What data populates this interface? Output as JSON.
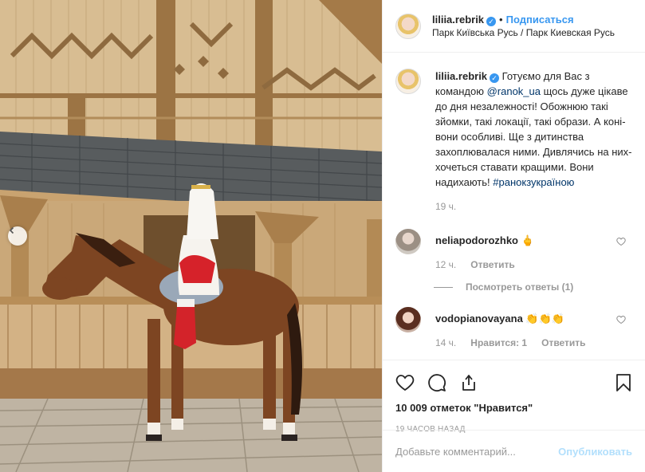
{
  "post": {
    "username": "liliia.rebrik",
    "verified_glyph": "✓",
    "separator": "•",
    "follow_label": "Подписаться",
    "location": "Парк Київська Русь / Парк Киевская Русь"
  },
  "caption": {
    "username": "liliia.rebrik",
    "text_1": " Готуємо для Вас з командою ",
    "mention": "@ranok_ua",
    "text_2": " щось дуже цікаве до дня незалежності! Обожнюю такі зйомки, такі локації, такі образи. А коні- вони особливі. Ще з дитинства захоплювалася ними. Дивлячись на них- хочеться ставати кращими. Вони надихають! ",
    "hashtag": "#ранокзукраїною",
    "time": "19 ч."
  },
  "comments": [
    {
      "username": "neliapodorozhko",
      "text": " 🖕",
      "time": "12 ч.",
      "reply_label": "Ответить",
      "view_replies": "Посмотреть ответы (1)"
    },
    {
      "username": "vodopianovayana",
      "text": " 👏👏👏",
      "time": "14 ч.",
      "likes_label": "Нравится: 1",
      "reply_label": "Ответить"
    }
  ],
  "actions": {
    "likes": "10 009 отметок \"Нравится\"",
    "posted_ago": "19 часов назад"
  },
  "add_comment": {
    "placeholder": "Добавьте комментарий...",
    "post_label": "Опубликовать"
  },
  "icons": {
    "prev": "chevron-left-icon",
    "like": "heart-icon",
    "comment": "comment-icon",
    "share": "share-icon",
    "save": "bookmark-icon"
  },
  "colors": {
    "accent": "#3897f0",
    "link": "#003569",
    "muted": "#999999",
    "post_disabled": "#b2dffc"
  }
}
